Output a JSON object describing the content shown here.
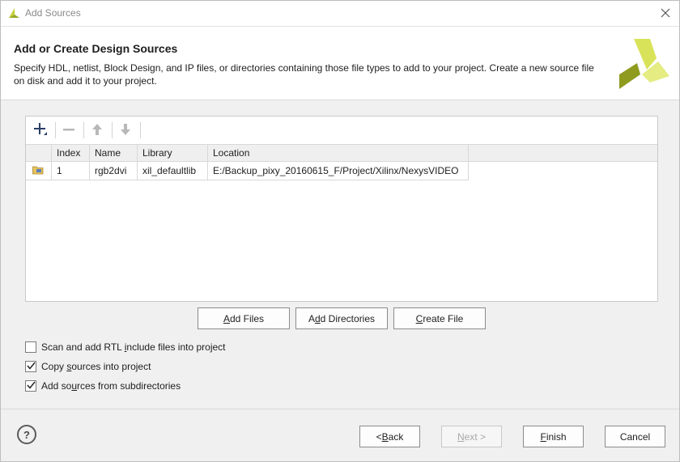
{
  "window": {
    "title": "Add Sources"
  },
  "header": {
    "title": "Add or Create Design Sources",
    "description": "Specify HDL, netlist, Block Design, and IP files, or directories containing those file types to add to your project. Create a new source file on disk and add it to your project."
  },
  "toolbar": {
    "add_icon": "plus-icon",
    "remove_icon": "minus-icon",
    "up_icon": "arrow-up-icon",
    "down_icon": "arrow-down-icon"
  },
  "table": {
    "columns": [
      "Index",
      "Name",
      "Library",
      "Location"
    ],
    "rows": [
      {
        "icon": "folder-icon",
        "index": "1",
        "name": "rgb2dvi",
        "library": "xil_defaultlib",
        "location": "E:/Backup_pixy_20160615_F/Project/Xilinx/NexysVIDEO"
      }
    ]
  },
  "actions": {
    "add_files": {
      "pre": "",
      "key": "A",
      "post": "dd Files"
    },
    "add_directories": {
      "pre": "A",
      "key": "d",
      "post": "d Directories"
    },
    "create_file": {
      "pre": "",
      "key": "C",
      "post": "reate File"
    }
  },
  "options": [
    {
      "pre": "Scan and add RTL ",
      "key": "i",
      "post": "nclude files into project",
      "checked": false
    },
    {
      "pre": "Copy ",
      "key": "s",
      "post": "ources into project",
      "checked": true
    },
    {
      "pre": "Add so",
      "key": "u",
      "post": "rces from subdirectories",
      "checked": true
    }
  ],
  "footer": {
    "help": "?",
    "back": {
      "pre": "< ",
      "key": "B",
      "post": "ack",
      "enabled": true
    },
    "next": {
      "pre": "",
      "key": "N",
      "post": "ext >",
      "enabled": false
    },
    "finish": {
      "pre": "",
      "key": "F",
      "post": "inish",
      "enabled": true
    },
    "cancel": {
      "label": "Cancel",
      "enabled": true
    }
  },
  "colors": {
    "logo_light": "#d6e356",
    "logo_dark": "#8a9a1c",
    "folder": "#e8c25a"
  }
}
